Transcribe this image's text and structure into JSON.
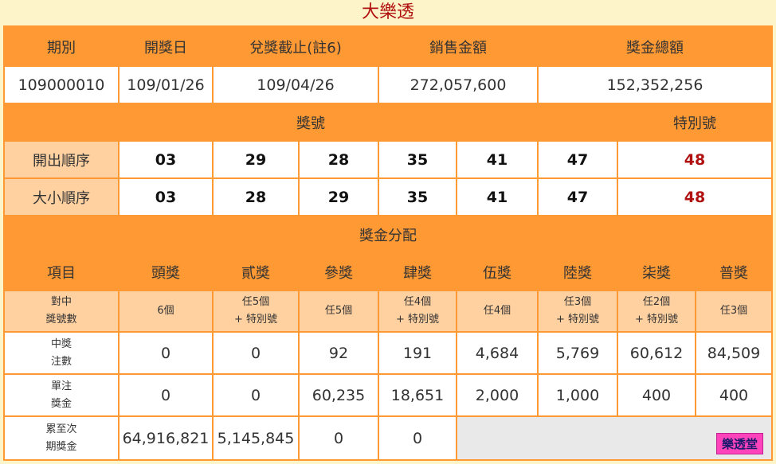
{
  "title": "大樂透",
  "info": {
    "headers": [
      "期別",
      "開獎日",
      "兌獎截止(註6)",
      "銷售金額",
      "獎金總額"
    ],
    "values": [
      "109000010",
      "109/01/26",
      "109/04/26",
      "272,057,600",
      "152,352,256"
    ]
  },
  "numbers": {
    "header_main": "獎號",
    "header_special": "特別號",
    "rows": [
      {
        "label": "開出順序",
        "nums": [
          "03",
          "29",
          "28",
          "35",
          "41",
          "47"
        ],
        "special": "48"
      },
      {
        "label": "大小順序",
        "nums": [
          "03",
          "28",
          "29",
          "35",
          "41",
          "47"
        ],
        "special": "48"
      }
    ],
    "special_color": "#b01010"
  },
  "prize": {
    "section_title": "獎金分配",
    "header": [
      "項目",
      "頭獎",
      "貳獎",
      "參獎",
      "肆獎",
      "伍獎",
      "陸獎",
      "柒獎",
      "普獎"
    ],
    "match": {
      "label": [
        "對中",
        "獎號數"
      ],
      "values": [
        [
          "6個"
        ],
        [
          "任5個",
          "+ 特別號"
        ],
        [
          "任5個"
        ],
        [
          "任4個",
          "+ 特別號"
        ],
        [
          "任4個"
        ],
        [
          "任3個",
          "+ 特別號"
        ],
        [
          "任2個",
          "+ 特別號"
        ],
        [
          "任3個"
        ]
      ]
    },
    "winners": {
      "label": [
        "中獎",
        "注數"
      ],
      "values": [
        "0",
        "0",
        "92",
        "191",
        "4,684",
        "5,769",
        "60,612",
        "84,509"
      ]
    },
    "amount": {
      "label": [
        "單注",
        "獎金"
      ],
      "values": [
        "0",
        "0",
        "60,235",
        "18,651",
        "2,000",
        "1,000",
        "400",
        "400"
      ]
    },
    "carryover": {
      "label": [
        "累至次",
        "期獎金"
      ],
      "values": [
        "64,916,821",
        "5,145,845",
        "0",
        "0"
      ]
    }
  },
  "watermark": "樂透堂",
  "colors": {
    "orange": "#ff9933",
    "light": "#ffd0a0",
    "title": "#b01010",
    "bg": "#fdf5c9"
  }
}
